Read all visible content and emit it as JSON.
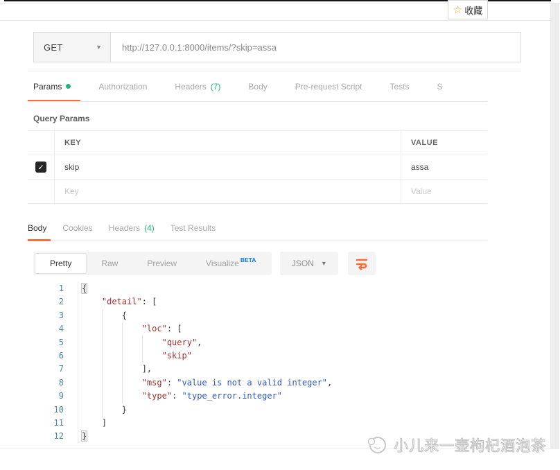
{
  "favorite": {
    "star": "☆",
    "label": "收藏"
  },
  "request": {
    "method": "GET",
    "method_chevron": "▼",
    "url": "http://127.0.0.1:8000/items/?skip=assa",
    "tabs": [
      {
        "label": "Params",
        "active": true,
        "dot": true
      },
      {
        "label": "Authorization"
      },
      {
        "label": "Headers",
        "count": "(7)"
      },
      {
        "label": "Body"
      },
      {
        "label": "Pre-request Script"
      },
      {
        "label": "Tests"
      },
      {
        "label": "S"
      }
    ],
    "query_params_title": "Query Params",
    "table": {
      "columns": [
        "KEY",
        "VALUE"
      ],
      "rows": [
        {
          "checked": true,
          "check_glyph": "✓",
          "key": "skip",
          "value": "assa"
        }
      ],
      "placeholder_row": {
        "key": "Key",
        "value": "Value"
      }
    }
  },
  "response": {
    "tabs": [
      {
        "label": "Body",
        "active": true
      },
      {
        "label": "Cookies"
      },
      {
        "label": "Headers",
        "count": "(4)"
      },
      {
        "label": "Test Results"
      }
    ],
    "view_modes": [
      {
        "label": "Pretty",
        "active": true
      },
      {
        "label": "Raw"
      },
      {
        "label": "Preview"
      },
      {
        "label": "Visualize",
        "badge": "BETA"
      }
    ],
    "format": "JSON",
    "format_chevron": "▼",
    "code": {
      "lines": [
        {
          "n": "1",
          "guides": [],
          "parts": [
            [
              "b",
              "{"
            ]
          ]
        },
        {
          "n": "2",
          "guides": [],
          "parts": [
            [
              "p",
              "    "
            ],
            [
              "k",
              "\"detail\""
            ],
            [
              "p",
              ": ["
            ]
          ]
        },
        {
          "n": "3",
          "guides": [
            4
          ],
          "parts": [
            [
              "p",
              "        {"
            ]
          ]
        },
        {
          "n": "4",
          "guides": [
            4,
            8
          ],
          "parts": [
            [
              "p",
              "            "
            ],
            [
              "k",
              "\"loc\""
            ],
            [
              "p",
              ": ["
            ]
          ]
        },
        {
          "n": "5",
          "guides": [
            4,
            8,
            12
          ],
          "parts": [
            [
              "p",
              "                "
            ],
            [
              "k",
              "\"query\""
            ],
            [
              "p",
              ","
            ]
          ]
        },
        {
          "n": "6",
          "guides": [
            4,
            8,
            12
          ],
          "parts": [
            [
              "p",
              "                "
            ],
            [
              "k",
              "\"skip\""
            ]
          ]
        },
        {
          "n": "7",
          "guides": [
            4,
            8
          ],
          "parts": [
            [
              "p",
              "            ],"
            ]
          ]
        },
        {
          "n": "8",
          "guides": [
            4,
            8
          ],
          "parts": [
            [
              "p",
              "            "
            ],
            [
              "k",
              "\"msg\""
            ],
            [
              "p",
              ": "
            ],
            [
              "s",
              "\"value is not a valid integer\""
            ],
            [
              "p",
              ","
            ]
          ]
        },
        {
          "n": "9",
          "guides": [
            4,
            8
          ],
          "parts": [
            [
              "p",
              "            "
            ],
            [
              "k",
              "\"type\""
            ],
            [
              "p",
              ": "
            ],
            [
              "s",
              "\"type_error.integer\""
            ]
          ]
        },
        {
          "n": "10",
          "guides": [
            4
          ],
          "parts": [
            [
              "p",
              "        }"
            ]
          ]
        },
        {
          "n": "11",
          "guides": [],
          "parts": [
            [
              "p",
              "    ]"
            ]
          ]
        },
        {
          "n": "12",
          "guides": [],
          "parts": [
            [
              "b",
              "}"
            ]
          ]
        }
      ]
    }
  },
  "watermark": {
    "text": "小儿来一壶枸杞酒泡茶"
  },
  "colors": {
    "accent_orange": "#ff6c37",
    "green": "#26b47e",
    "beta_blue": "#0c7ae0",
    "code_key_red": "#a4302d",
    "code_string_blue": "#3159bf",
    "line_number_blue": "#4d87a3",
    "star_orange": "#f5a623"
  }
}
